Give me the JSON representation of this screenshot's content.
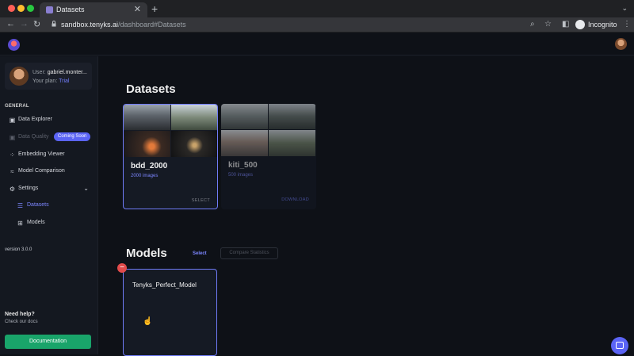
{
  "browser": {
    "tab_title": "Datasets",
    "tab_close": "✕",
    "new_tab": "+",
    "url_host": "sandbox.tenyks.ai",
    "url_path": "/dashboard#Datasets",
    "incognito_label": "Incognito"
  },
  "user": {
    "user_prefix": "User:",
    "name": "gabriel.monter...",
    "plan_prefix": "Your plan:",
    "plan": "Trial"
  },
  "sidebar": {
    "section": "GENERAL",
    "items": [
      {
        "label": "Data Explorer",
        "icon": "chart-icon"
      },
      {
        "label": "Data Quality",
        "icon": "quality-icon",
        "badge": "Coming Soon"
      },
      {
        "label": "Embedding Viewer",
        "icon": "embedding-icon"
      },
      {
        "label": "Model Comparison",
        "icon": "comparison-icon"
      },
      {
        "label": "Settings",
        "icon": "gear-icon"
      }
    ],
    "sub_items": [
      {
        "label": "Datasets",
        "icon": "list-icon"
      },
      {
        "label": "Models",
        "icon": "grid-icon"
      }
    ],
    "version": "version 3.0.0",
    "help_title": "Need help?",
    "help_sub": "Check our docs",
    "doc_button": "Documentation"
  },
  "datasets": {
    "heading": "Datasets",
    "cards": [
      {
        "title": "bdd_2000",
        "count": "2000 images",
        "action": "SELECT"
      },
      {
        "title": "kiti_500",
        "count": "500 images",
        "action": "DOWNLOAD"
      }
    ]
  },
  "models": {
    "heading": "Models",
    "select_label": "Select",
    "compare_label": "Compare Statistics",
    "cards": [
      {
        "title": "Tenyks_Perfect_Model",
        "remove": "−"
      }
    ]
  },
  "colors": {
    "accent": "#6f7bf7",
    "doc_button": "#19a46a",
    "remove": "#e24b4b",
    "background": "#0e1117"
  }
}
